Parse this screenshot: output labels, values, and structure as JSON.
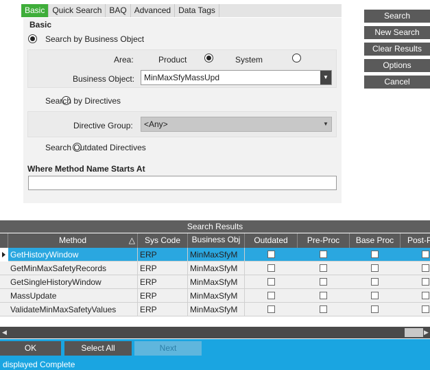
{
  "tabs": [
    {
      "label": "Basic",
      "active": true
    },
    {
      "label": "Quick Search"
    },
    {
      "label": "BAQ"
    },
    {
      "label": "Advanced"
    },
    {
      "label": "Data Tags"
    }
  ],
  "buttons": {
    "search": "Search",
    "new_search": "New Search",
    "clear_results": "Clear Results",
    "options": "Options",
    "cancel": "Cancel"
  },
  "basic": {
    "group_title": "Basic",
    "by_business_object": "Search by Business Object",
    "area_label": "Area:",
    "area_product": "Product",
    "area_system": "System",
    "business_object_label": "Business Object:",
    "business_object_value": "MinMaxSfyMassUpd",
    "by_directives": "Search by Directives",
    "directive_group_label": "Directive Group:",
    "directive_group_value": "<Any>",
    "outdated_directives": "Search Outdated Directives"
  },
  "where": {
    "title": "Where Method Name Starts At",
    "value": ""
  },
  "results": {
    "title": "Search Results",
    "columns": [
      "Method",
      "Sys Code",
      "Business Obj",
      "Outdated",
      "Pre-Proc",
      "Base Proc",
      "Post-P"
    ],
    "sort_indicator": "△",
    "rows": [
      {
        "method": "GetHistoryWindow",
        "sys": "ERP",
        "bo": "MinMaxSfyM"
      },
      {
        "method": "GetMinMaxSafetyRecords",
        "sys": "ERP",
        "bo": "MinMaxSfyM"
      },
      {
        "method": "GetSingleHistoryWindow",
        "sys": "ERP",
        "bo": "MinMaxSfyM"
      },
      {
        "method": "MassUpdate",
        "sys": "ERP",
        "bo": "MinMaxSfyM"
      },
      {
        "method": "ValidateMinMaxSafetyValues",
        "sys": "ERP",
        "bo": "MinMaxSfyM"
      }
    ]
  },
  "bottom": {
    "ok": "OK",
    "select_all": "Select All",
    "next": "Next",
    "status_1": "displayed",
    "status_2": "Complete"
  }
}
